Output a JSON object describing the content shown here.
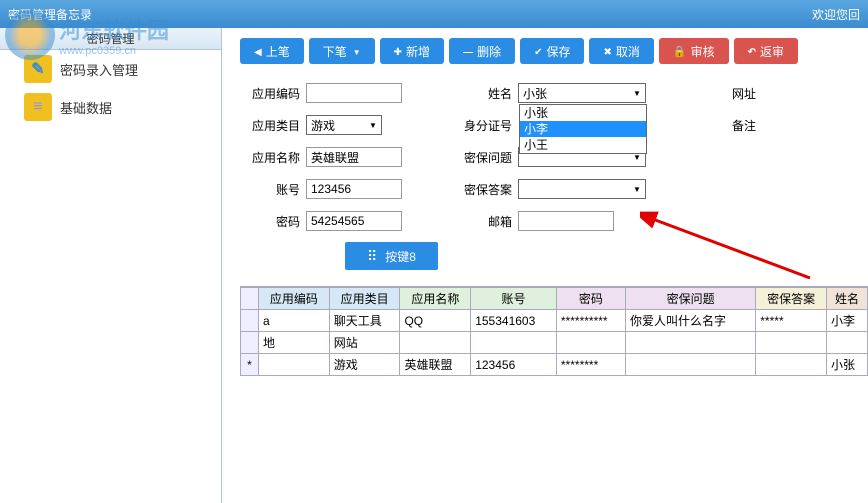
{
  "titlebar": {
    "title": "密码管理备忘录",
    "right": "欢迎您回"
  },
  "watermark": {
    "cn": "河东软件园",
    "url": "www.pc0359.cn"
  },
  "sidebar": {
    "header": "密码管理",
    "items": [
      {
        "label": "密码录入管理"
      },
      {
        "label": "基础数据"
      }
    ]
  },
  "toolbar": {
    "prev": "上笔",
    "next": "下笔",
    "add": "新增",
    "del": "删除",
    "save": "保存",
    "cancel": "取消",
    "audit": "审核",
    "return": "返审"
  },
  "form": {
    "labels": {
      "appCode": "应用编码",
      "appCat": "应用类目",
      "appName": "应用名称",
      "account": "账号",
      "password": "密码",
      "name": "姓名",
      "idcard": "身分证号",
      "secQ": "密保问题",
      "secA": "密保答案",
      "email": "邮箱",
      "website": "网址",
      "remark": "备注"
    },
    "values": {
      "appCode": "",
      "appCat": "游戏",
      "appName": "英雄联盟",
      "account": "123456",
      "password": "54254565",
      "name": "小张",
      "idcard": "",
      "secQ": "",
      "secA": "",
      "email": ""
    },
    "nameOptions": [
      "小张",
      "小李",
      "小王"
    ],
    "nameSelectedIndex": 1,
    "button8": "按键8"
  },
  "table": {
    "headers": [
      "应用编码",
      "应用类目",
      "应用名称",
      "账号",
      "密码",
      "密保问题",
      "密保答案",
      "姓名"
    ],
    "rows": [
      {
        "marker": "",
        "cells": [
          "a",
          "聊天工具",
          "QQ",
          "155341603",
          "**********",
          "你爱人叫什么名字",
          "*****",
          "小李"
        ]
      },
      {
        "marker": "",
        "cells": [
          "地",
          "网站",
          "",
          "",
          "",
          "",
          "",
          ""
        ]
      },
      {
        "marker": "*",
        "cells": [
          "",
          "游戏",
          "英雄联盟",
          "123456",
          "********",
          "",
          "",
          "小张"
        ]
      }
    ]
  }
}
